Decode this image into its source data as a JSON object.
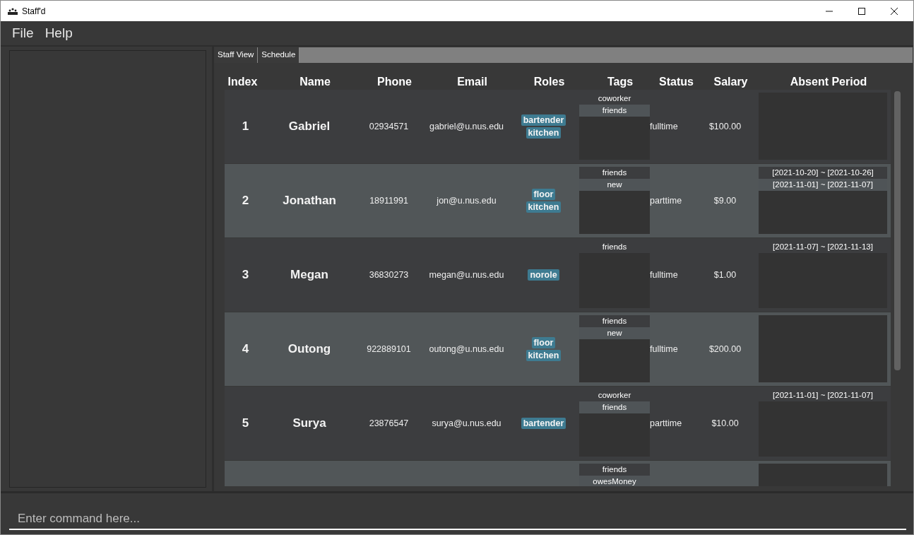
{
  "window": {
    "title": "Staff'd"
  },
  "menu": [
    "File",
    "Help"
  ],
  "tabs": [
    "Staff View",
    "Schedule"
  ],
  "table": {
    "columns": [
      "Index",
      "Name",
      "Phone",
      "Email",
      "Roles",
      "Tags",
      "Status",
      "Salary",
      "Absent Period"
    ],
    "rows": [
      {
        "index": "1",
        "name": "Gabriel",
        "phone": "02934571",
        "email": "gabriel@u.nus.edu",
        "roles": [
          "bartender",
          "kitchen"
        ],
        "tags": [
          "coworker",
          "friends"
        ],
        "status": "fulltime",
        "salary": "$100.00"
      },
      {
        "index": "2",
        "name": "Jonathan",
        "phone": "18911991",
        "email": "jon@u.nus.edu",
        "roles": [
          "floor",
          "kitchen"
        ],
        "tags": [
          "friends",
          "new"
        ],
        "status": "parttime",
        "salary": "$9.00",
        "absent_periods": [
          "[2021-10-20] ~ [2021-10-26]",
          "[2021-11-01] ~ [2021-11-07]"
        ]
      },
      {
        "index": "3",
        "name": "Megan",
        "phone": "36830273",
        "email": "megan@u.nus.edu",
        "roles": [
          "norole"
        ],
        "tags": [
          "friends"
        ],
        "status": "fulltime",
        "salary": "$1.00",
        "absent_periods": [
          "[2021-11-07] ~ [2021-11-13]"
        ]
      },
      {
        "index": "4",
        "name": "Outong",
        "phone": "922889101",
        "email": "outong@u.nus.edu",
        "roles": [
          "floor",
          "kitchen"
        ],
        "tags": [
          "friends",
          "new"
        ],
        "status": "fulltime",
        "salary": "$200.00"
      },
      {
        "index": "5",
        "name": "Surya",
        "phone": "23876547",
        "email": "surya@u.nus.edu",
        "roles": [
          "bartender"
        ],
        "tags": [
          "coworker",
          "friends"
        ],
        "status": "parttime",
        "salary": "$10.00",
        "absent_periods": [
          "[2021-11-01] ~ [2021-11-07]"
        ]
      },
      {
        "tags": [
          "friends",
          "owesMoney"
        ]
      }
    ]
  },
  "command_box": {
    "placeholder": "Enter command here..."
  }
}
